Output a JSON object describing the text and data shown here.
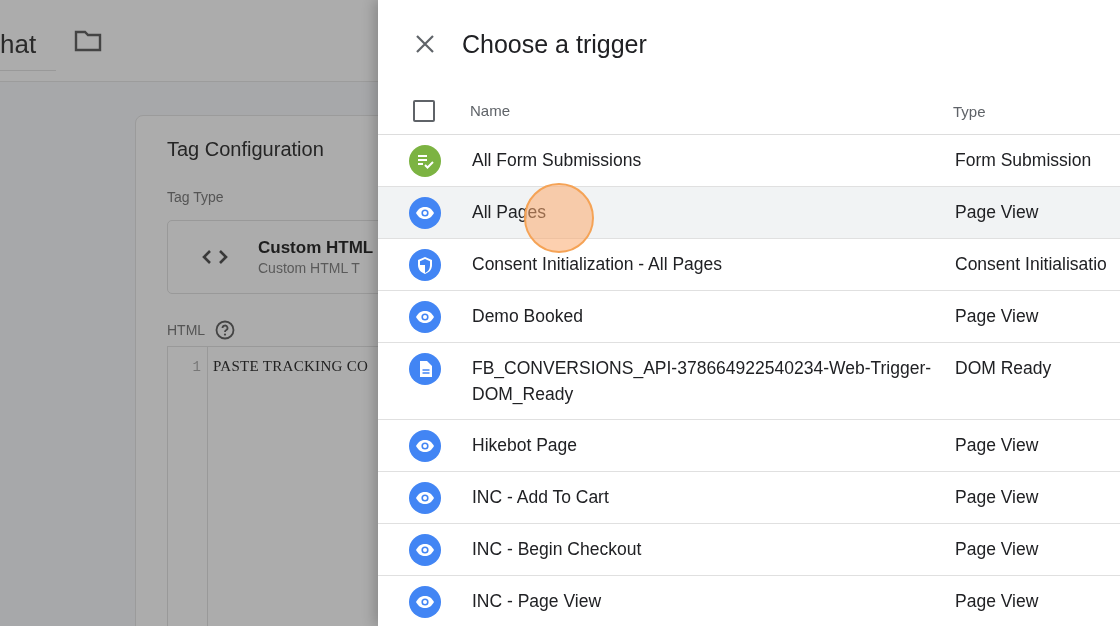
{
  "background": {
    "name_field_value": "hat",
    "card": {
      "title": "Tag Configuration",
      "tag_type_label": "Tag Type",
      "tag_type": {
        "title": "Custom HTML",
        "subtitle": "Custom HTML T"
      },
      "html_label": "HTML",
      "editor": {
        "line_number": "1",
        "code": "PASTE TRACKING CO"
      }
    }
  },
  "panel": {
    "title": "Choose a trigger",
    "select_all_checked": false,
    "columns": [
      "Name",
      "Type"
    ],
    "rows": [
      {
        "kind": "form",
        "name": "All Form Submissions",
        "type": "Form Submission",
        "highlighted": false
      },
      {
        "kind": "eye",
        "name": "All Pages",
        "type": "Page View",
        "highlighted": true
      },
      {
        "kind": "shield",
        "name": "Consent Initialization - All Pages",
        "type": "Consent Initialisatio",
        "highlighted": false
      },
      {
        "kind": "eye",
        "name": "Demo Booked",
        "type": "Page View",
        "highlighted": false
      },
      {
        "kind": "document",
        "name": "FB_CONVERSIONS_API-378664922540234-Web-Trigger-DOM_Ready",
        "type": "DOM Ready",
        "highlighted": false
      },
      {
        "kind": "eye",
        "name": "Hikebot Page",
        "type": "Page View",
        "highlighted": false
      },
      {
        "kind": "eye",
        "name": "INC - Add To Cart",
        "type": "Page View",
        "highlighted": false
      },
      {
        "kind": "eye",
        "name": "INC - Begin Checkout",
        "type": "Page View",
        "highlighted": false
      },
      {
        "kind": "eye",
        "name": "INC - Page View",
        "type": "Page View",
        "highlighted": false
      }
    ]
  }
}
